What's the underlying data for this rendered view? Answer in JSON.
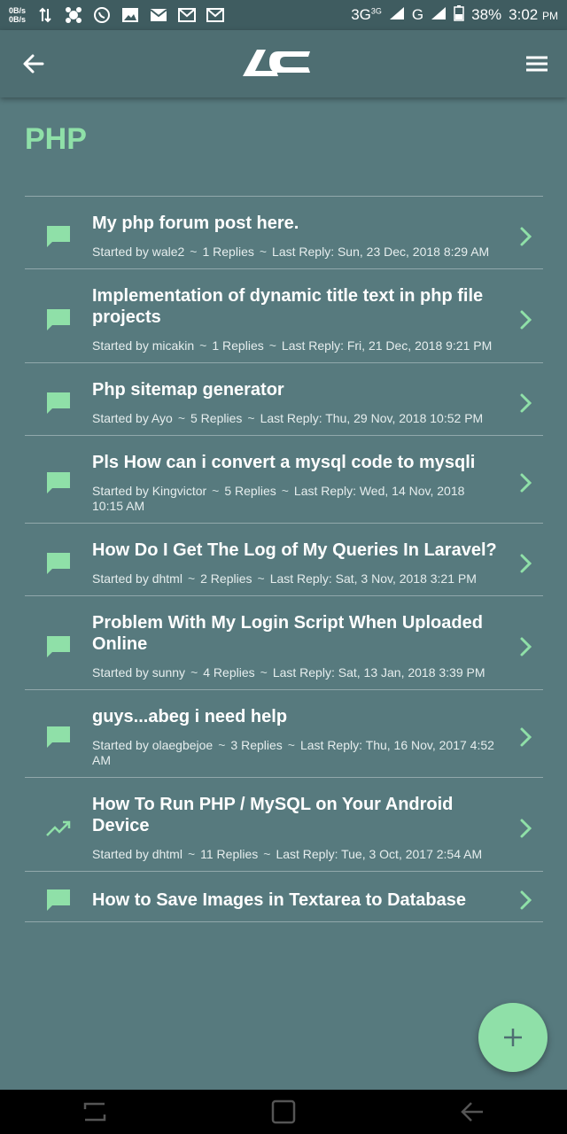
{
  "status_bar": {
    "speed_up": "0B/s",
    "speed_down": "0B/s",
    "network_1": "3G",
    "network_1_small": "3G",
    "network_2": "G",
    "battery": "38%",
    "time": "3:02",
    "ampm": "PM"
  },
  "page": {
    "title": "PHP"
  },
  "topics": [
    {
      "title": "My php forum post here.",
      "author": "Started by wale2",
      "replies": "1 Replies",
      "last_reply": "Last Reply: Sun, 23 Dec, 2018 8:29 AM",
      "icon": "chat-icon"
    },
    {
      "title": "Implementation of dynamic title text in php file projects",
      "author": "Started by micakin",
      "replies": "1 Replies",
      "last_reply": "Last Reply: Fri, 21 Dec, 2018 9:21 PM",
      "icon": "chat-icon"
    },
    {
      "title": "Php sitemap generator",
      "author": "Started by Ayo",
      "replies": "5 Replies",
      "last_reply": "Last Reply: Thu, 29 Nov, 2018 10:52 PM",
      "icon": "chat-icon"
    },
    {
      "title": "Pls How can i convert a mysql code to mysqli",
      "author": "Started by Kingvictor",
      "replies": "5 Replies",
      "last_reply": "Last Reply: Wed, 14 Nov, 2018  10:15 AM",
      "icon": "chat-icon"
    },
    {
      "title": "How Do I Get The Log of My Queries In Laravel?",
      "author": "Started by dhtml",
      "replies": "2 Replies",
      "last_reply": "Last Reply: Sat, 3 Nov, 2018 3:21 PM",
      "icon": "chat-icon"
    },
    {
      "title": "Problem With My Login Script When Uploaded Online",
      "author": "Started by sunny",
      "replies": "4 Replies",
      "last_reply": "Last Reply: Sat, 13 Jan, 2018 3:39 PM",
      "icon": "chat-icon"
    },
    {
      "title": "guys...abeg i need help",
      "author": "Started by olaegbejoe",
      "replies": "3 Replies",
      "last_reply": "Last Reply: Thu, 16 Nov, 2017  4:52 AM",
      "icon": "chat-icon"
    },
    {
      "title": "How To Run PHP / MySQL on Your Android Device",
      "author": "Started by dhtml",
      "replies": "11 Replies",
      "last_reply": "Last Reply: Tue, 3 Oct, 2017 2:54 AM",
      "icon": "trending-icon"
    },
    {
      "title": "How to Save Images in Textarea to Database",
      "author": "",
      "replies": "",
      "last_reply": "",
      "icon": "chat-icon"
    }
  ],
  "separator": "~",
  "fab": {
    "icon": "plus-icon"
  },
  "colors": {
    "background": "#577a7e",
    "app_bar": "#4e6e72",
    "accent": "#8fe0a8"
  }
}
